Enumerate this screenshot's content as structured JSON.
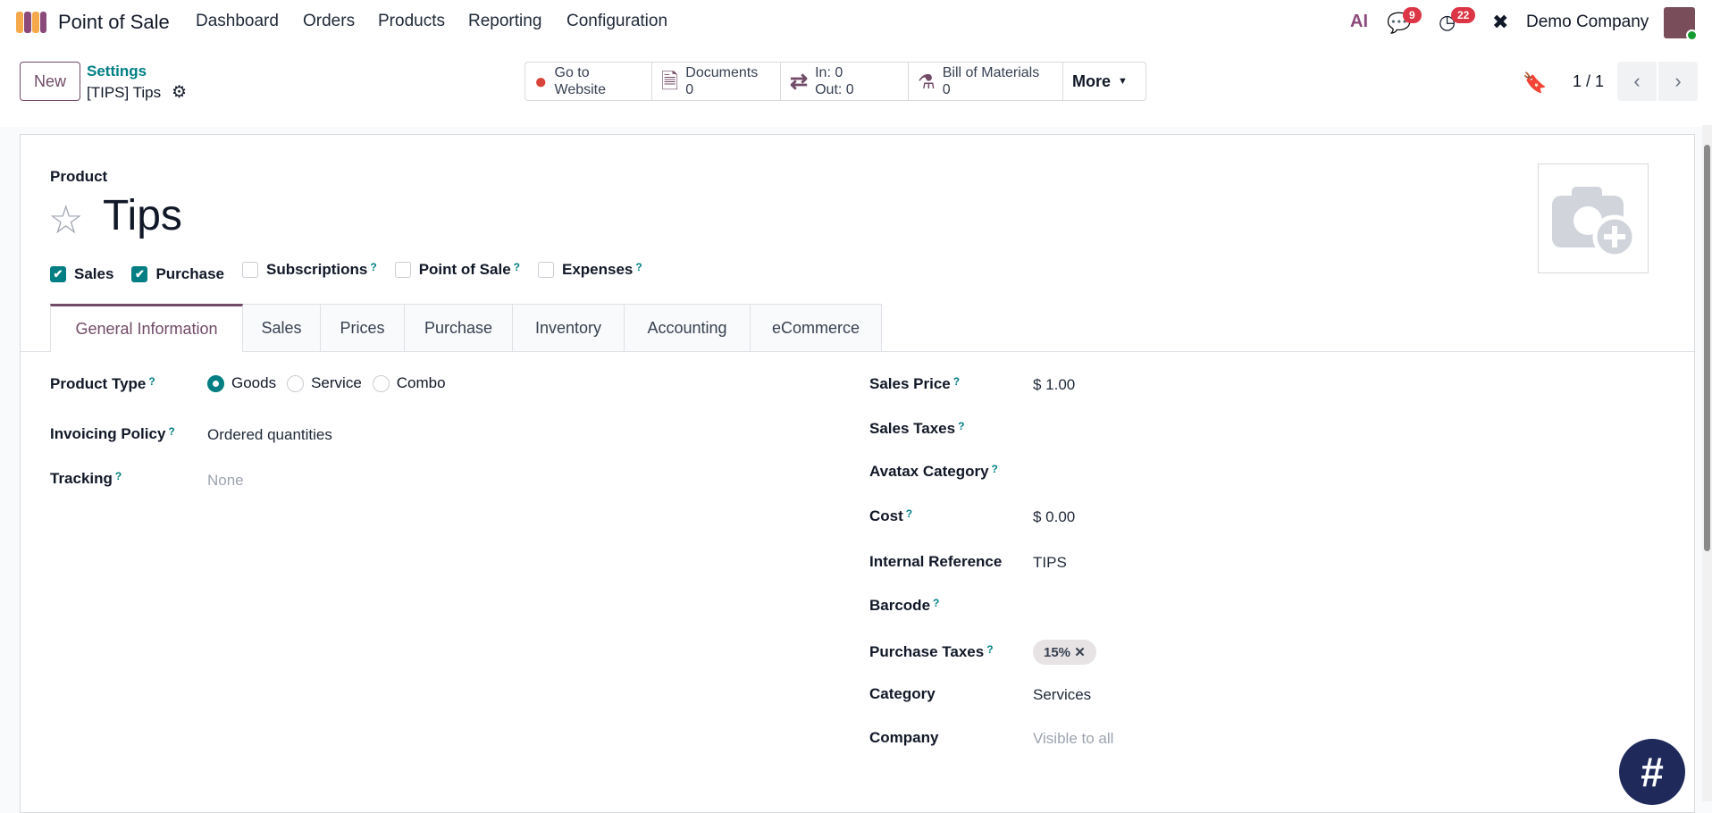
{
  "nav": {
    "app_title": "Point of Sale",
    "menu": [
      "Dashboard",
      "Orders",
      "Products",
      "Reporting",
      "Configuration"
    ],
    "messages_count": "9",
    "activities_count": "22",
    "company": "Demo Company",
    "ai_label": "AI"
  },
  "control": {
    "new_label": "New",
    "breadcrumb_parent": "Settings",
    "record_name": "[TIPS] Tips",
    "pager": "1 / 1",
    "smart_buttons": {
      "website": [
        "Go to",
        "Website"
      ],
      "documents": [
        "Documents",
        "0"
      ],
      "moves": [
        "In: 0",
        "Out: 0"
      ],
      "bom": [
        "Bill of Materials",
        "0"
      ],
      "more": "More"
    }
  },
  "form": {
    "model_label": "Product",
    "name": "Tips",
    "flags": [
      {
        "label": "Sales",
        "checked": true
      },
      {
        "label": "Purchase",
        "checked": true
      },
      {
        "label": "Subscriptions",
        "checked": false,
        "help": "?"
      },
      {
        "label": "Point of Sale",
        "checked": false,
        "help": "?"
      },
      {
        "label": "Expenses",
        "checked": false,
        "help": "?"
      }
    ],
    "tabs": [
      "General Information",
      "Sales",
      "Prices",
      "Purchase",
      "Inventory",
      "Accounting",
      "eCommerce"
    ],
    "left": {
      "product_type_label": "Product Type",
      "product_type_options": [
        "Goods",
        "Service",
        "Combo"
      ],
      "product_type_selected": "Goods",
      "invoicing_label": "Invoicing Policy",
      "invoicing_value": "Ordered quantities",
      "tracking_label": "Tracking",
      "tracking_value": "None"
    },
    "right": [
      {
        "label": "Sales Price",
        "help": true,
        "value": "$ 1.00"
      },
      {
        "label": "Sales Taxes",
        "help": true,
        "value": ""
      },
      {
        "label": "Avatax Category",
        "help": true,
        "value": ""
      },
      {
        "label": "Cost",
        "help": true,
        "value": "$ 0.00"
      },
      {
        "label": "Internal Reference",
        "help": false,
        "value": "TIPS"
      },
      {
        "label": "Barcode",
        "help": true,
        "value": ""
      },
      {
        "label": "Purchase Taxes",
        "help": true,
        "tag": "15%"
      },
      {
        "label": "Category",
        "help": false,
        "value": "Services"
      },
      {
        "label": "Company",
        "help": false,
        "value": "Visible to all",
        "placeholder": true
      }
    ],
    "help_mark": "?"
  },
  "colors": {
    "brand": "#714b67",
    "accent": "#017e84",
    "badge": "#dc3545"
  }
}
